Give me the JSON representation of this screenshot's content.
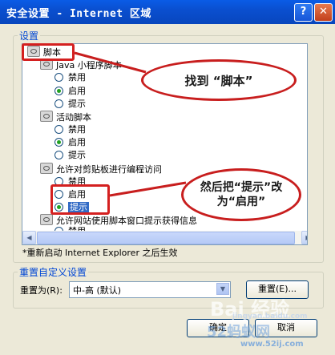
{
  "window": {
    "title": "安全设置 - Internet 区域",
    "help_glyph": "?",
    "close_glyph": "✕"
  },
  "settings_group": {
    "label": "设置"
  },
  "tree": {
    "scripting": "脚本",
    "java_applets": "Java 小程序脚本",
    "active_scripting": "活动脚本",
    "clipboard_access": "允许对剪贴板进行编程访问",
    "status_bar": "允许网站使用脚本窗口提示获得信息",
    "opt_disable": "禁用",
    "opt_enable": "启用",
    "opt_prompt": "提示"
  },
  "note": "*重新启动 Internet Explorer 之后生效",
  "reset_group": {
    "label": "重置自定义设置",
    "reset_to_label": "重置为(R):",
    "combo_value": "中-高 (默认)",
    "reset_button": "重置(E)..."
  },
  "footer": {
    "ok_button": "确定",
    "cancel_button": "取消"
  },
  "annotations": {
    "callout_find": "找到 “脚本”",
    "callout_change": "然后把“提示”改为“启用”"
  },
  "watermark": {
    "brand": "Bai 经验",
    "url": "jingyan.baidu.com",
    "site2": "52蚂蚁网",
    "url2": "www.52ij.com"
  },
  "colors": {
    "titlebar": "#0a4fd0",
    "accent_red": "#c81e1e",
    "selection": "#316ac5"
  }
}
